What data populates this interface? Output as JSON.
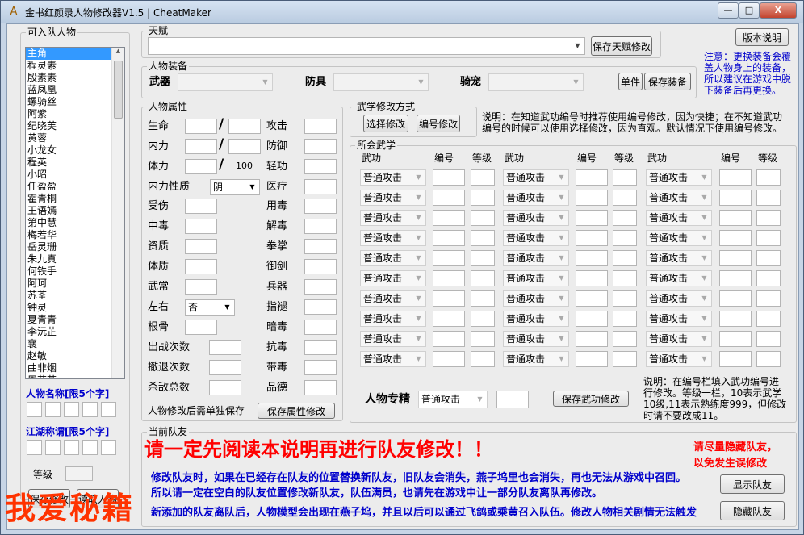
{
  "window": {
    "title": "金书红颜录人物修改器V1.5 | CheatMaker",
    "minimize": "—",
    "maximize": "□",
    "close": "X"
  },
  "left": {
    "group_title": "可入队人物",
    "characters": [
      "主角",
      "程灵素",
      "殷素素",
      "蓝凤凰",
      "螺骑丝",
      "阿紫",
      "纪晓芙",
      "黄蓉",
      "小龙女",
      "程英",
      "小昭",
      "任盈盈",
      "霍青桐",
      "王语嫣",
      "第中慧",
      "梅若华",
      "岳灵珊",
      "朱九真",
      "何铁手",
      "阿珂",
      "苏荃",
      "钟灵",
      "夏青青",
      "李沅芷",
      "襄",
      "赵敏",
      "曲非烟",
      "周芷若"
    ],
    "selected_index": 0,
    "name_label": "人物名称[限5个字]",
    "title_label": "江湖称谓[限5个字]",
    "level_label": "等级",
    "btn_save": "保存修改",
    "btn_read": "读取人物"
  },
  "talent": {
    "group_title": "天赋",
    "value": "",
    "save_btn": "保存天赋修改"
  },
  "version_btn": "版本说明",
  "equip": {
    "group_title": "人物装备",
    "weapon_label": "武器",
    "armor_label": "防具",
    "mount_label": "骑宠",
    "single_btn": "单件",
    "save_btn": "保存装备",
    "note": "注意：更换装备会覆盖人物身上的装备，所以建议在游戏中脱下装备后再更换。"
  },
  "attrs": {
    "group_title": "人物属性",
    "left": [
      "生命",
      "内力",
      "体力",
      "内力性质",
      "受伤",
      "中毒",
      "资质",
      "体质",
      "武常",
      "左右",
      "根骨",
      "出战次数",
      "撤退次数",
      "杀敌总数"
    ],
    "right": [
      "攻击",
      "防御",
      "轻功",
      "医疗",
      "用毒",
      "解毒",
      "拳掌",
      "御剑",
      "兵器",
      "指褪",
      "暗毒",
      "抗毒",
      "带毒",
      "品德"
    ],
    "slash": "/",
    "stamina_max": "100",
    "neili_type": "阴",
    "zuoyou": "否",
    "footer": "人物修改后需单独保存",
    "save_btn": "保存属性修改"
  },
  "method": {
    "group_title": "武学修改方式",
    "select_btn": "选择修改",
    "code_btn": "编号修改",
    "note": "说明：在知道武功编号时推荐使用编号修改，因为快捷；在不知道武功编号的时候可以使用选择修改，因为直观。默认情况下使用编号修改。"
  },
  "skills": {
    "group_title": "所会武学",
    "col_skill": "武功",
    "col_code": "编号",
    "col_level": "等级",
    "default_skill": "普通攻击",
    "rows": 10,
    "special_label": "人物专精",
    "special_value": "普通攻击",
    "save_btn": "保存武功修改",
    "note": "说明：在编号栏填入武功编号进行修改。等级一栏，10表示武学10级,11表示熟练度999，但修改时请不要改成11。"
  },
  "team": {
    "group_title": "当前队友",
    "warning": "请一定先阅读本说明再进行队友修改！！",
    "side_note": "请尽量隐藏队友，以免发生误修改",
    "lines": [
      "修改队友时，如果在已经存在队友的位置替换新队友，旧队友会消失，燕子坞里也会消失，再也无法从游戏中召回。",
      "所以请一定在空白的队友位置修改新队友，队伍满员，也请先在游戏中让一部分队友离队再修改。",
      "新添加的队友离队后，人物模型会出现在燕子坞，并且以后可以通过飞鸽或乘黄召入队伍。修改人物相关剧情无法触发"
    ],
    "show_btn": "显示队友",
    "hide_btn": "隐藏队友"
  },
  "watermark": "我爱秘籍",
  "colors": {
    "accent_blue": "#0000cc",
    "warning_red": "#ff0000",
    "selection": "#3399ff"
  }
}
